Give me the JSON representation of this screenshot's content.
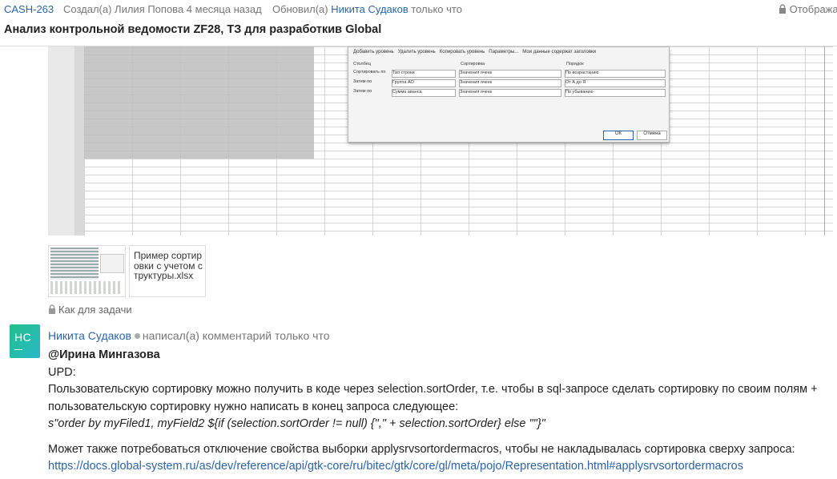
{
  "header": {
    "issue_key": "CASH-263",
    "created_text": "Создал(а) Лилия Попова 4 месяца назад",
    "updated_prefix": "Обновил(а)",
    "updated_author": "Никита Судаков",
    "updated_suffix": "только что",
    "visibility_right": "Отобража",
    "title": "Анализ контрольной ведомости ZF28, ТЗ для разработкив Global"
  },
  "screenshot": {
    "dialog_toolbar": [
      "Добавить уровень",
      "Удалить уровень",
      "Копировать уровень",
      "Параметры...",
      "Мои данные содержат заголовки"
    ],
    "columns": [
      "Столбец",
      "Сортировка",
      "Порядок"
    ],
    "rows": [
      {
        "label": "Сортировать по",
        "column": "Тип строки",
        "sort": "Значения ячеек",
        "order": "По возрастанию"
      },
      {
        "label": "Затем по",
        "column": "Группа АО",
        "sort": "Значения ячеек",
        "order": "От А до Я"
      },
      {
        "label": "Затем по",
        "column": "Сумма аванса",
        "sort": "Значения ячеек",
        "order": "По убыванию"
      }
    ],
    "ok_label": "ОК",
    "cancel_label": "Отмена"
  },
  "attachment": {
    "file_name": "Пример сортировки с учетом структуры.xlsx"
  },
  "visibility": {
    "label": "Как для задачи",
    "icon": "lock-icon"
  },
  "comment": {
    "avatar_initials": "НС",
    "author": "Никита Судаков",
    "action": "написал(а) комментарий только что",
    "mention": "@Ирина Мингазова",
    "line1": "UPD:",
    "line2": "Пользовательскую сортировку можно получить в коде через selection.sortOrder, т.е. чтобы в sql-запросе сделать сортировку по своим полям + пользовательскую сортировку нужно написать в конец запроса следующее:",
    "code": "s\"order by myFiled1, myField2 ${if (selection.sortOrder != null) {\",\" + selection.sortOrder} else \"\"}\"",
    "line3": "Может также потребоваться отключение свойства выборки applysrvsortordermacros, чтобы не накладывалась сортировка сверху запроса:",
    "link": "https://docs.global-system.ru/as/dev/reference/api/gtk-core/ru/bitec/gtk/core/gl/meta/pojo/Representation.html#applysrvsortordermacros"
  },
  "colors": {
    "link": "#2a64a8",
    "avatar_start": "#22c08a",
    "avatar_end": "#29b8c8"
  }
}
